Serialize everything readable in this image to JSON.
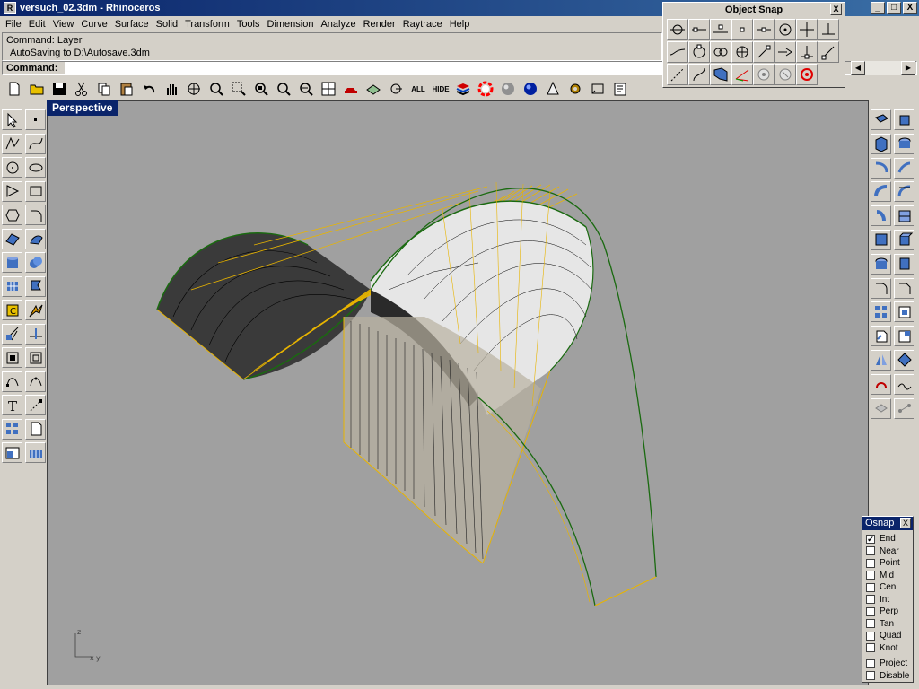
{
  "window": {
    "title": "versuch_02.3dm - Rhinoceros",
    "min_label": "_",
    "max_label": "□",
    "close_label": "X"
  },
  "menu": [
    "File",
    "Edit",
    "View",
    "Curve",
    "Surface",
    "Solid",
    "Transform",
    "Tools",
    "Dimension",
    "Analyze",
    "Render",
    "Raytrace",
    "Help"
  ],
  "command": {
    "history_line1": "Command: Layer",
    "history_line2": "AutoSaving to D:\\Autosave.3dm",
    "prompt": "Command:"
  },
  "toolbar": {
    "all_label": "ALL",
    "hide_label": "HIDE"
  },
  "object_snap": {
    "title": "Object Snap",
    "close_label": "X"
  },
  "viewport": {
    "label": "Perspective",
    "axis_z": "z",
    "axis_x": "x",
    "axis_y": "y"
  },
  "osnap": {
    "title": "Osnap",
    "close_label": "X",
    "checked_mark": "✔",
    "items": [
      {
        "label": "End",
        "checked": true
      },
      {
        "label": "Near",
        "checked": false
      },
      {
        "label": "Point",
        "checked": false
      },
      {
        "label": "Mid",
        "checked": false
      },
      {
        "label": "Cen",
        "checked": false
      },
      {
        "label": "Int",
        "checked": false
      },
      {
        "label": "Perp",
        "checked": false
      },
      {
        "label": "Tan",
        "checked": false
      },
      {
        "label": "Quad",
        "checked": false
      },
      {
        "label": "Knot",
        "checked": false
      }
    ],
    "extra": [
      {
        "label": "Project",
        "checked": false
      },
      {
        "label": "Disable",
        "checked": false
      }
    ]
  },
  "colors": {
    "title_bar": "#0a246a",
    "viewport_bg": "#a0a0a0",
    "curve_yellow": "#e8b400",
    "curve_green": "#2a7a1a"
  }
}
